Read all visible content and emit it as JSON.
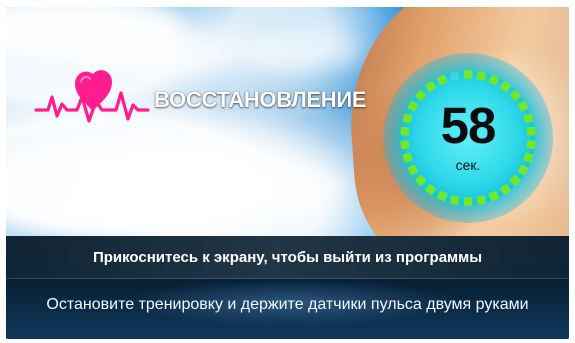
{
  "screen": {
    "mode_title": "ВОССТАНОВЛЕНИЕ",
    "heart_icon": "heart-pulse-icon",
    "accent_color": "#ff1f8f",
    "timer": {
      "value": "58",
      "unit": "сек.",
      "ring_color": "#72e62a",
      "glow_color": "#10d7e8",
      "progress": 0.97
    }
  },
  "bottom_panel": {
    "exit_hint": "Прикоснитесь к экрану, чтобы выйти из программы",
    "instruction": "Остановите тренировку и держите датчики пульса двумя руками"
  }
}
